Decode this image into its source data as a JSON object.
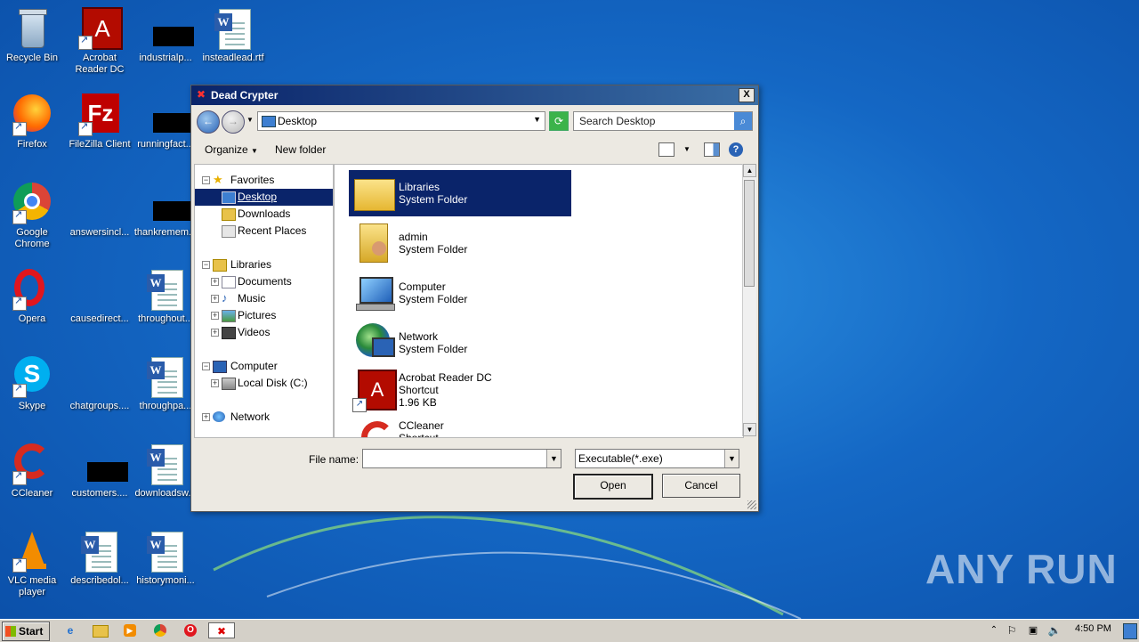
{
  "desktop": {
    "icons": [
      {
        "label": "Recycle Bin"
      },
      {
        "label": "Acrobat Reader DC"
      },
      {
        "label": "industrialp..."
      },
      {
        "label": "insteadlead.rtf"
      },
      {
        "label": "Firefox"
      },
      {
        "label": "FileZilla Client"
      },
      {
        "label": "runningfact..."
      },
      {
        "label": "Google Chrome"
      },
      {
        "label": "answersincl..."
      },
      {
        "label": "thankremem..."
      },
      {
        "label": "Opera"
      },
      {
        "label": "causedirect..."
      },
      {
        "label": "throughout..."
      },
      {
        "label": "Skype"
      },
      {
        "label": "chatgroups...."
      },
      {
        "label": "throughpa..."
      },
      {
        "label": "CCleaner"
      },
      {
        "label": "customers...."
      },
      {
        "label": "downloadsw..."
      },
      {
        "label": "VLC media player"
      },
      {
        "label": "describedol..."
      },
      {
        "label": "historymoni..."
      }
    ],
    "watermark": "ANY RUN"
  },
  "dialog": {
    "title": "Dead Crypter",
    "close_glyph": "X",
    "address": "Desktop",
    "search_placeholder": "Search Desktop",
    "toolbar": {
      "organize": "Organize",
      "new_folder": "New folder",
      "help": "?"
    },
    "nav": {
      "favorites": "Favorites",
      "desktop": "Desktop",
      "downloads": "Downloads",
      "recent": "Recent Places",
      "libraries": "Libraries",
      "documents": "Documents",
      "music": "Music",
      "pictures": "Pictures",
      "videos": "Videos",
      "computer": "Computer",
      "localdisk": "Local Disk (C:)",
      "network": "Network"
    },
    "items": [
      {
        "name": "Libraries",
        "type": "System Folder",
        "size": ""
      },
      {
        "name": "admin",
        "type": "System Folder",
        "size": ""
      },
      {
        "name": "Computer",
        "type": "System Folder",
        "size": ""
      },
      {
        "name": "Network",
        "type": "System Folder",
        "size": ""
      },
      {
        "name": "Acrobat Reader DC",
        "type": "Shortcut",
        "size": "1.96 KB"
      },
      {
        "name": "CCleaner",
        "type": "Shortcut",
        "size": ""
      }
    ],
    "filename_label": "File name:",
    "filename_value": "",
    "filetype_value": "Executable(*.exe)",
    "open_label": "Open",
    "cancel_label": "Cancel"
  },
  "taskbar": {
    "start_label": "Start",
    "clock": "4:50 PM"
  },
  "colors": {
    "selection": "#0a246a",
    "desktop": "#1467c4",
    "title_gradient_start": "#0a246a"
  }
}
